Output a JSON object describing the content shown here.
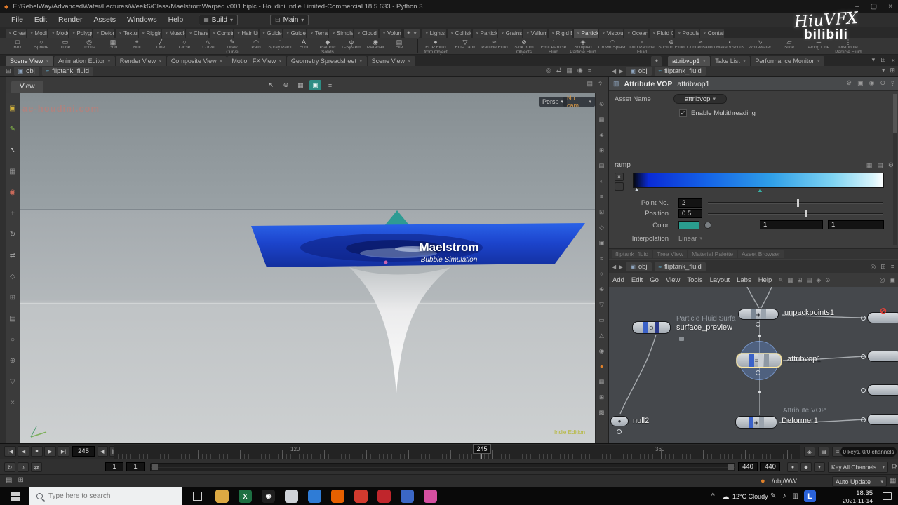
{
  "glyphs": {
    "diamond": "◆",
    "screen": "⊟",
    "grid": "▦",
    "list": "▤",
    "down": "▾",
    "left": "◀",
    "right": "▶",
    "plus": "+",
    "x": "×",
    "check": "✓",
    "gear": "⚙",
    "help": "?",
    "cam": "◉",
    "target": "⊙",
    "swap": "⇄",
    "pin": "◎",
    "menu": "≡",
    "cube": "▣",
    "water": "≈",
    "dot": "●",
    "caret": "^",
    "cloud": "☁",
    "note": "♪",
    "pen": "✎",
    "panel": "▥",
    "boxes": "⊞",
    "diam": "◈",
    "upmark": "▲",
    "sel": "↖",
    "circle": "○"
  },
  "titlebar": {
    "title": "E:/RebelWay/AdvancedWater/Lectures/Week6/Class/MaelstromWarped.v001.hiplc - Houdini Indie Limited-Commercial 18.5.633 - Python 3",
    "min": "–",
    "max": "▢",
    "close": "×"
  },
  "watermark": {
    "brand": "HiuVFX",
    "site": "bilibili"
  },
  "menubar": {
    "items": [
      "File",
      "Edit",
      "Render",
      "Assets",
      "Windows",
      "Help"
    ],
    "build": "Build",
    "main": "Main"
  },
  "shelf": {
    "tabs_left": [
      "Create",
      "Modify",
      "Model",
      "Polygon",
      "Deform",
      "Texture",
      "Rigging",
      "Muscles",
      "Charact",
      "Constrai",
      "Hair Utils",
      "Guide P",
      "Guide B",
      "Terrain",
      "Simple FX",
      "Cloud FX",
      "Volume"
    ],
    "plus": "+",
    "tabs_right": [
      "Lights and",
      "Collisions",
      "Particles",
      "Grains",
      "Vellum",
      "Rigid Bod",
      "Particle Fl",
      "Viscous Fl",
      "Oceans",
      "Fluid Con",
      "Populate C",
      "Container"
    ],
    "tools_left": [
      {
        "glyph": "□",
        "label": "Box"
      },
      {
        "glyph": "○",
        "label": "Sphere"
      },
      {
        "glyph": "▭",
        "label": "Tube"
      },
      {
        "glyph": "◎",
        "label": "Torus"
      },
      {
        "glyph": "▦",
        "label": "Grid"
      },
      {
        "glyph": "+",
        "label": "Null"
      },
      {
        "glyph": "╱",
        "label": "Line"
      },
      {
        "glyph": "○",
        "label": "Circle"
      },
      {
        "glyph": "∿",
        "label": "Curve"
      },
      {
        "glyph": "✎",
        "label": "Draw Curve"
      },
      {
        "glyph": "◠",
        "label": "Path"
      },
      {
        "glyph": "∴",
        "label": "Spray Paint"
      },
      {
        "glyph": "A",
        "label": "Font"
      },
      {
        "glyph": "◆",
        "label": "Platonic Solids"
      },
      {
        "glyph": "ψ",
        "label": "L-System"
      },
      {
        "glyph": "◉",
        "label": "Metaball"
      },
      {
        "glyph": "▤",
        "label": "File"
      }
    ],
    "tools_right": [
      {
        "glyph": "●",
        "label": "FLIP Fluid from Object"
      },
      {
        "glyph": "▽",
        "label": "FLIP Tank"
      },
      {
        "glyph": "≈",
        "label": "Particle Fluid"
      },
      {
        "glyph": "⊘",
        "label": "Sink from Objects"
      },
      {
        "glyph": "∴",
        "label": "Emit Particle Fluid"
      },
      {
        "glyph": "◈",
        "label": "Sculpted Particle Fluid"
      },
      {
        "glyph": "◠",
        "label": "Crown Splash"
      },
      {
        "glyph": "◦",
        "label": "Drip Particle Fluid"
      },
      {
        "glyph": "⊖",
        "label": "Suction Fluid"
      },
      {
        "glyph": "≈",
        "label": "Condensation"
      },
      {
        "glyph": "◐",
        "label": "Make Viscous"
      },
      {
        "glyph": "∿",
        "label": "Whitewater"
      },
      {
        "glyph": "▱",
        "label": "Slice"
      },
      {
        "glyph": "─",
        "label": "Along Line"
      },
      {
        "glyph": "⋮",
        "label": "Distribute Particle Fluid"
      }
    ]
  },
  "pane_tabs": {
    "left": [
      "Scene View",
      "Animation Editor",
      "Render View",
      "Composite View",
      "Motion FX View",
      "Geometry Spreadsheet",
      "Scene View"
    ],
    "right": [
      "attribvop1",
      "Take List",
      "Performance Monitor"
    ],
    "plus": "+"
  },
  "pathbar": {
    "root": "obj",
    "node": "fliptank_fluid"
  },
  "viewport": {
    "tab": "View",
    "persp": "Persp",
    "no_cam": "No cam",
    "title": "Maelstrom",
    "subtitle": "Bubble Simulation",
    "site": "ae-houdini.com",
    "edition": "Indie Edition",
    "center_icons": [
      {
        "glyph": "↖"
      },
      {
        "glyph": "⊕"
      },
      {
        "glyph": "▦"
      },
      {
        "glyph": "▣"
      },
      {
        "glyph": "≡"
      }
    ],
    "left_tools": [
      {
        "glyph": "▣",
        "color": "#d4b33c"
      },
      {
        "glyph": "✎",
        "color": "#8bc34a"
      },
      {
        "glyph": "↖",
        "color": "#c8c8c8"
      },
      {
        "glyph": "▦",
        "color": "#9a9a9a"
      },
      {
        "glyph": "◉",
        "color": "#c96a5a"
      },
      {
        "glyph": "+",
        "color": "#9a9a9a"
      },
      {
        "glyph": "↻",
        "color": "#9a9a9a"
      },
      {
        "glyph": "⇄",
        "color": "#9a9a9a"
      },
      {
        "glyph": "◇",
        "color": "#9a9a9a"
      },
      {
        "glyph": "⊞",
        "color": "#9a9a9a"
      },
      {
        "glyph": "▤",
        "color": "#9a9a9a"
      },
      {
        "glyph": "○",
        "color": "#9a9a9a"
      },
      {
        "glyph": "⊕",
        "color": "#9a9a9a"
      },
      {
        "glyph": "▽",
        "color": "#9a9a9a"
      },
      {
        "glyph": "×",
        "color": "#8a8a8a"
      }
    ],
    "right_tools": [
      {
        "glyph": "⊙"
      },
      {
        "glyph": "▦"
      },
      {
        "glyph": "◈"
      },
      {
        "glyph": "⊞"
      },
      {
        "glyph": "▤"
      },
      {
        "glyph": "◐"
      },
      {
        "glyph": "≡"
      },
      {
        "glyph": "⊡"
      },
      {
        "glyph": "◇"
      },
      {
        "glyph": "▣"
      },
      {
        "glyph": "≈"
      },
      {
        "glyph": "○"
      },
      {
        "glyph": "⊕"
      },
      {
        "glyph": "▽"
      },
      {
        "glyph": "▭"
      },
      {
        "glyph": "△"
      },
      {
        "glyph": "◉"
      },
      {
        "glyph": "●",
        "color": "#e0812a"
      },
      {
        "glyph": "▦"
      },
      {
        "glyph": "⊞"
      },
      {
        "glyph": "▩"
      }
    ]
  },
  "params": {
    "type": "Attribute VOP",
    "name": "attribvop1",
    "header_icons": [
      {
        "glyph": "⚙"
      },
      {
        "glyph": "▣"
      },
      {
        "glyph": "◉"
      },
      {
        "glyph": "⊙"
      },
      {
        "glyph": "?"
      }
    ],
    "asset_label": "Asset Name",
    "asset_value": "attribvop",
    "mt_label": "Enable Multithreading",
    "ramp_label": "ramp",
    "ramp_icons": [
      {
        "glyph": "▦"
      },
      {
        "glyph": "▤"
      },
      {
        "glyph": "⚙"
      }
    ],
    "point_label": "Point No.",
    "point_value": "2",
    "pos_label": "Position",
    "pos_value": "0.5",
    "color_label": "Color",
    "color_hex": "#2a9d8f",
    "val1": "1",
    "val2": "1",
    "interp_label": "Interpolation",
    "interp_value": "Linear"
  },
  "network": {
    "faded_tabs": [
      "fliptank_fluid",
      "Tree View",
      "Material Palette",
      "Asset Browser"
    ],
    "plus": "+",
    "menu": [
      "Add",
      "Edit",
      "Go",
      "View",
      "Tools",
      "Layout",
      "Labs",
      "Help"
    ],
    "menu_icons": [
      {
        "glyph": "✎"
      },
      {
        "glyph": "▦"
      },
      {
        "glyph": "⊞"
      },
      {
        "glyph": "▤"
      },
      {
        "glyph": "◈"
      },
      {
        "glyph": "⊙"
      }
    ],
    "nodes": {
      "unpack": "unpackpoints1",
      "surface": "surface_preview",
      "surface_dim": "Particle Fluid Surfa",
      "attrib": "attribvop1",
      "null2": "null2",
      "deformer": "Deformer1",
      "deformer_dim": "Attribute VOP",
      "bypass": "⊘"
    }
  },
  "timeline": {
    "transport": [
      {
        "glyph": "|◀"
      },
      {
        "glyph": "◀"
      },
      {
        "glyph": "■"
      },
      {
        "glyph": "▶"
      },
      {
        "glyph": "▶|"
      }
    ],
    "steps": [
      {
        "glyph": "◀|"
      },
      {
        "glyph": "|▶"
      }
    ],
    "frame": "245",
    "marker": "245",
    "tick1": "120",
    "tick2": "360",
    "right_icons": [
      {
        "glyph": "◈"
      },
      {
        "glyph": "▤"
      },
      {
        "glyph": "≡"
      }
    ],
    "keys": "0 keys, 0/0 channels",
    "row2_icons": [
      {
        "glyph": "↻"
      },
      {
        "glyph": "♪"
      },
      {
        "glyph": "⇄"
      }
    ],
    "start1": "1",
    "start2": "1",
    "end1": "440",
    "end2": "440",
    "mid_icons": [
      {
        "glyph": "●"
      },
      {
        "glyph": "◆"
      },
      {
        "glyph": "▾"
      }
    ],
    "key_mode": "Key All Channels"
  },
  "statusbar": {
    "icons": [
      {
        "glyph": "▤"
      },
      {
        "glyph": "⊞"
      }
    ],
    "path": "/obj/WW",
    "auto": "Auto Update"
  },
  "taskbar": {
    "search": "Type here to search",
    "weather": "12°C Cloudy",
    "time": "18:35",
    "date": "2021-11-14",
    "lbadge": "L",
    "apps": [
      {
        "color": "#dca943"
      },
      {
        "color": "#1d6f42",
        "glyph": "X"
      },
      {
        "color": "#1f1f1f",
        "glyph": "◉"
      },
      {
        "color": "#cfd3d8"
      },
      {
        "color": "#2f7cd6"
      },
      {
        "color": "#e66000"
      },
      {
        "color": "#d23a2e"
      },
      {
        "color": "#c0262c"
      },
      {
        "color": "#3b67c5"
      },
      {
        "color": "#d64fa0"
      }
    ],
    "tray_icons": [
      {
        "glyph": "✎"
      },
      {
        "glyph": "♪"
      },
      {
        "glyph": "▥"
      }
    ]
  }
}
